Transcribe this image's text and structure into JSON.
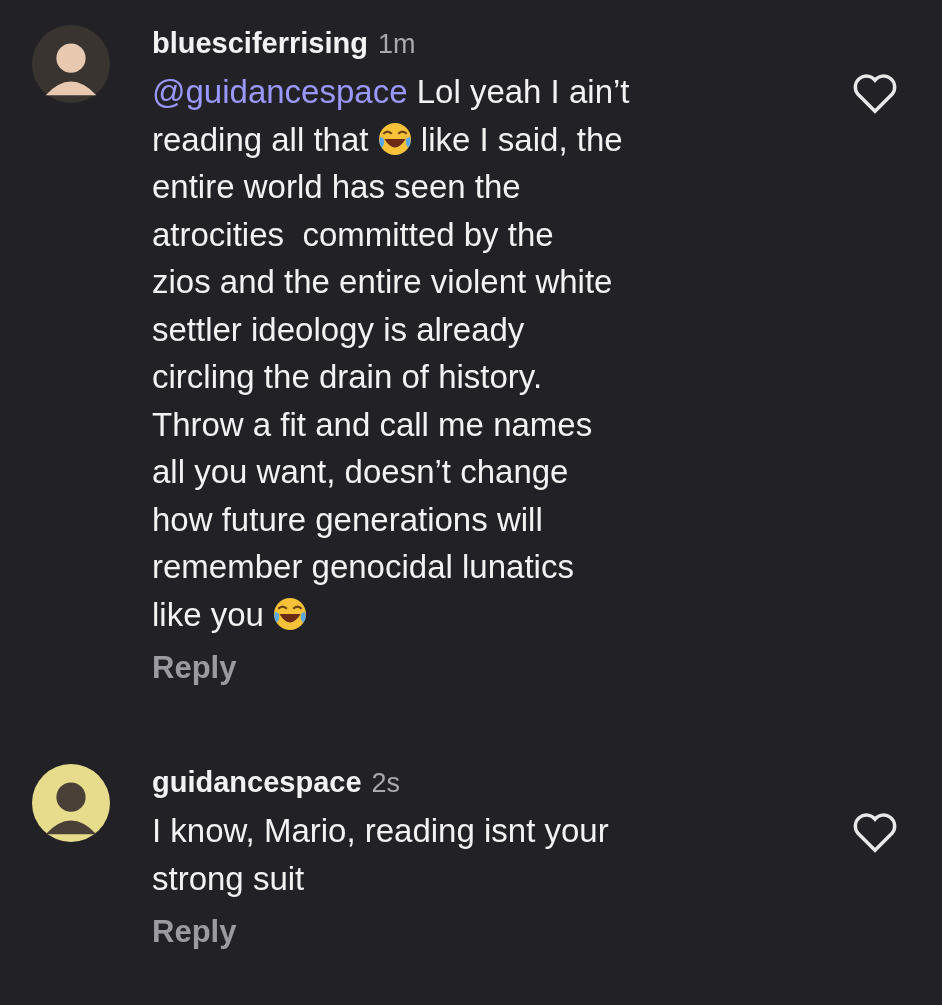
{
  "comments": [
    {
      "username": "bluesciferrising",
      "time": "1m",
      "avatar": {
        "kind": "picture"
      },
      "liked": false,
      "reply": "Reply",
      "lines": [
        [
          {
            "kind": "mention",
            "text": "@guidancespace"
          },
          {
            "kind": "text",
            "text": " Lol yeah I ain’t"
          }
        ],
        [
          {
            "kind": "text",
            "text": "reading all that "
          },
          {
            "kind": "emoji"
          },
          {
            "kind": "text",
            "text": " like I said, the"
          }
        ],
        [
          {
            "kind": "text",
            "text": "entire world has seen the"
          }
        ],
        [
          {
            "kind": "text",
            "text": "atrocities  committed by the"
          }
        ],
        [
          {
            "kind": "text",
            "text": "zios and the entire violent white"
          }
        ],
        [
          {
            "kind": "text",
            "text": "settler ideology is already"
          }
        ],
        [
          {
            "kind": "text",
            "text": "circling the drain of history."
          }
        ],
        [
          {
            "kind": "text",
            "text": "Throw a fit and call me names"
          }
        ],
        [
          {
            "kind": "text",
            "text": "all you want, doesn’t change"
          }
        ],
        [
          {
            "kind": "text",
            "text": "how future generations will"
          }
        ],
        [
          {
            "kind": "text",
            "text": "remember genocidal lunatics"
          }
        ],
        [
          {
            "kind": "text",
            "text": "like you "
          },
          {
            "kind": "emoji"
          }
        ]
      ]
    },
    {
      "username": "guidancespace",
      "time": "2s",
      "avatar": {
        "kind": "picture"
      },
      "liked": false,
      "reply": "Reply",
      "lines": [
        [
          {
            "kind": "text",
            "text": "I know, Mario, reading isnt your"
          }
        ],
        [
          {
            "kind": "text",
            "text": "strong suit"
          }
        ]
      ]
    }
  ]
}
